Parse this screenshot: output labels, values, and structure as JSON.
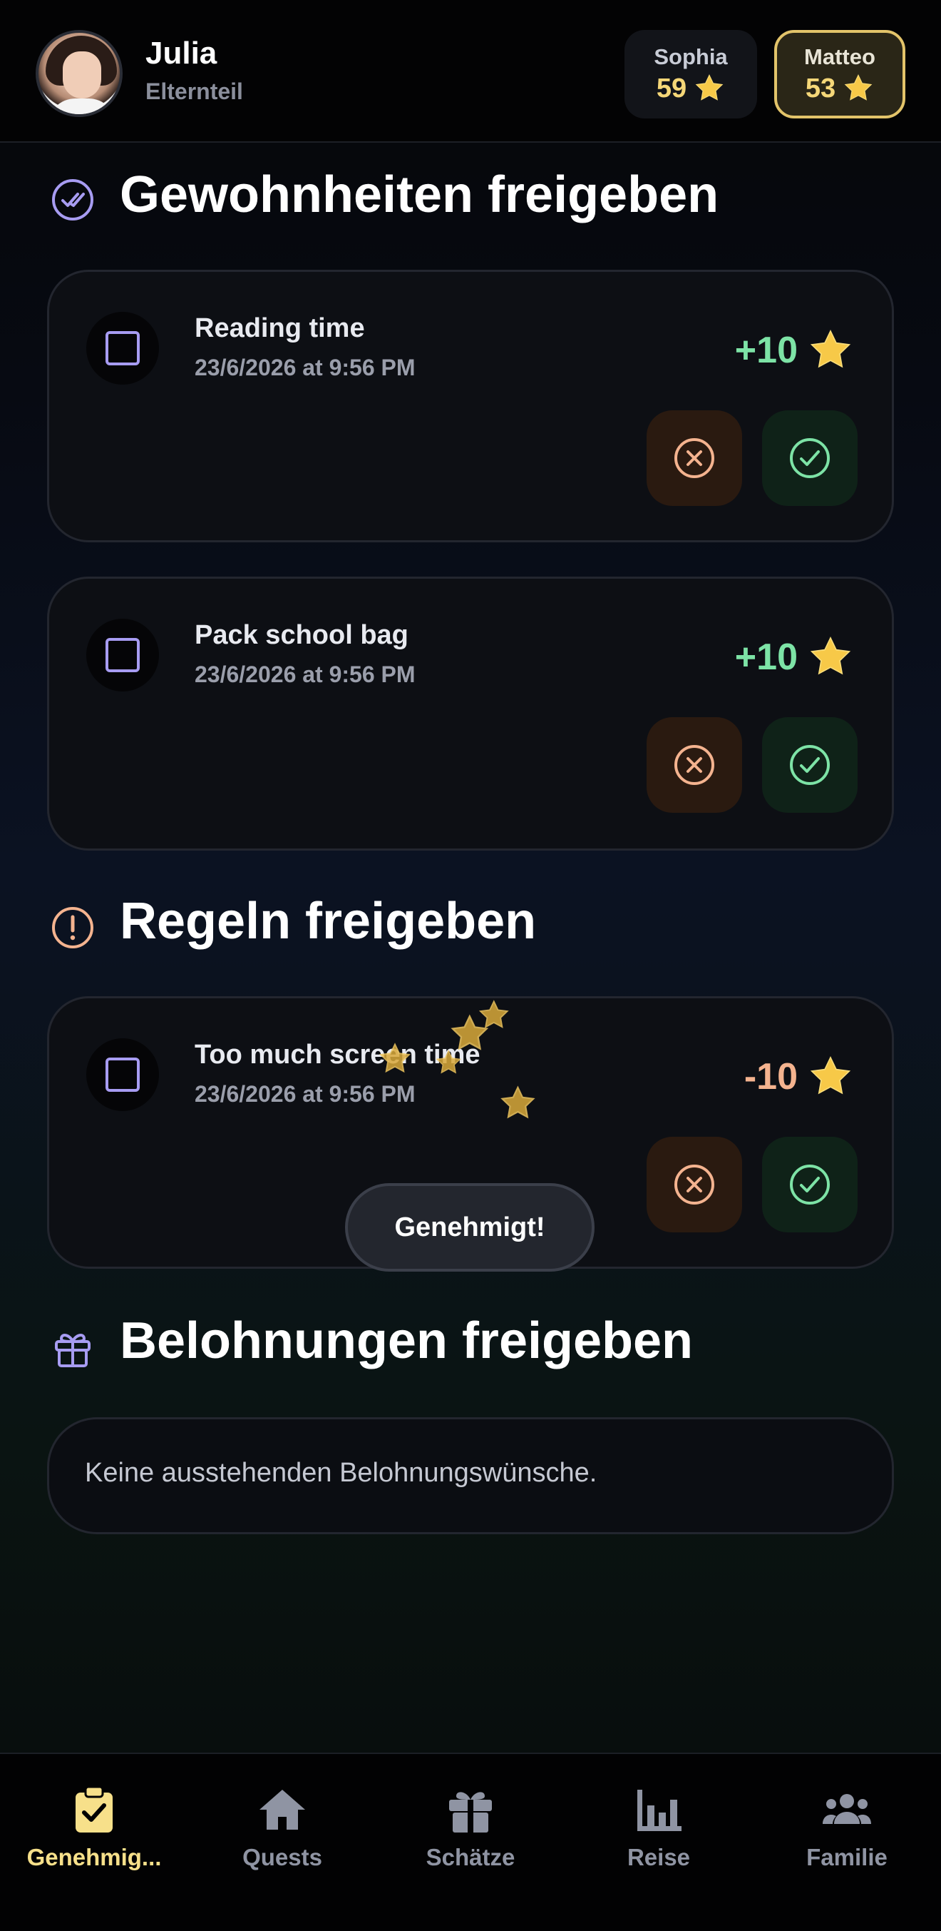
{
  "header": {
    "user_name": "Julia",
    "user_role": "Elternteil",
    "kids": [
      {
        "name": "Sophia",
        "stars": "59",
        "selected": false
      },
      {
        "name": "Matteo",
        "stars": "53",
        "selected": true
      }
    ]
  },
  "sections": {
    "habits": {
      "title": "Gewohnheiten freigeben",
      "items": [
        {
          "title": "Reading time",
          "date": "23/6/2026 at 9:56 PM",
          "points": "+10"
        },
        {
          "title": "Pack school bag",
          "date": "23/6/2026 at 9:56 PM",
          "points": "+10"
        }
      ]
    },
    "rules": {
      "title": "Regeln freigeben",
      "items": [
        {
          "title": "Too much screen time",
          "date": "23/6/2026 at 9:56 PM",
          "points": "-10"
        }
      ]
    },
    "rewards": {
      "title": "Belohnungen freigeben",
      "empty_text": "Keine ausstehenden Belohnungswünsche."
    }
  },
  "toast": "Genehmigt!",
  "nav": [
    {
      "label": "Genehmig...",
      "icon": "clipboard-check-icon",
      "active": true
    },
    {
      "label": "Quests",
      "icon": "home-icon",
      "active": false
    },
    {
      "label": "Schätze",
      "icon": "gift-icon",
      "active": false
    },
    {
      "label": "Reise",
      "icon": "bar-chart-icon",
      "active": false
    },
    {
      "label": "Familie",
      "icon": "group-icon",
      "active": false
    }
  ],
  "colors": {
    "accent_gold": "#f7e08a",
    "positive": "#7de3a6",
    "negative": "#f4b38f",
    "checkbox": "#a79cf2"
  }
}
